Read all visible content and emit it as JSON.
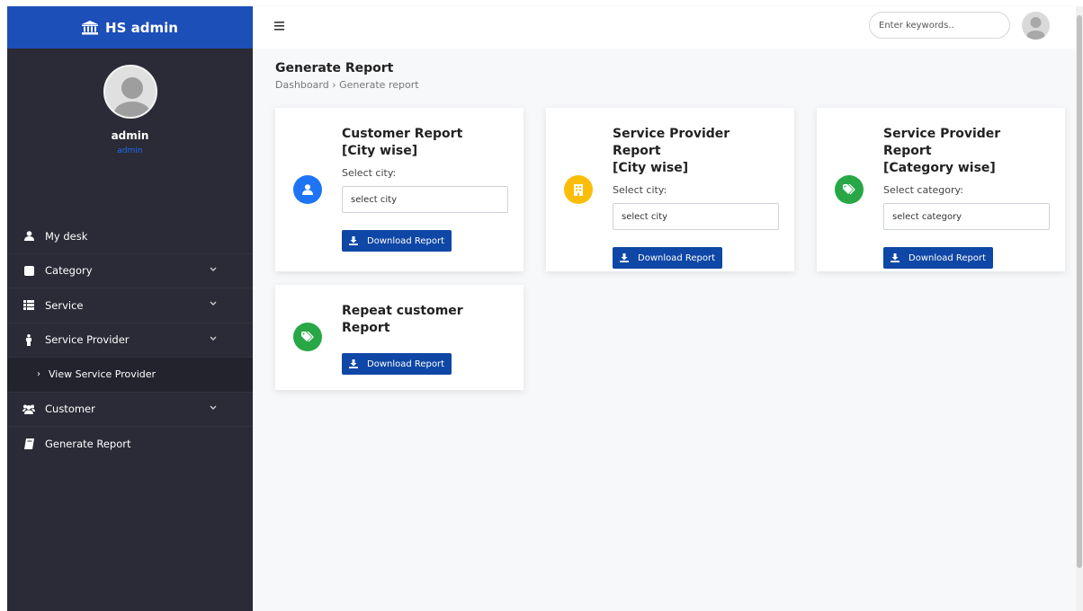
{
  "brand": {
    "title": "HS admin",
    "icon": "bank-icon"
  },
  "profile": {
    "name": "admin",
    "role": "admin"
  },
  "sidebar": {
    "items": [
      {
        "label": "My desk",
        "icon": "user-icon"
      },
      {
        "label": "Category",
        "icon": "square-icon",
        "has_children": true
      },
      {
        "label": "Service",
        "icon": "list-icon",
        "has_children": true
      },
      {
        "label": "Service Provider",
        "icon": "person-icon",
        "has_children": true
      },
      {
        "label": "View Service Provider",
        "icon": "chevron-right-icon",
        "sub": true
      },
      {
        "label": "Customer",
        "icon": "users-icon",
        "has_children": true
      },
      {
        "label": "Generate Report",
        "icon": "book-icon"
      }
    ]
  },
  "topbar": {
    "search_placeholder": "Enter keywords.."
  },
  "page": {
    "title": "Generate Report",
    "breadcrumb": "Dashboard › Generate report"
  },
  "cards": [
    {
      "title_line1": "Customer Report",
      "title_line2": "[City wise]",
      "field_label": "Select city:",
      "select_value": "select city",
      "button": "Download Report",
      "icon": "user-icon",
      "icon_color": "#1e74f5"
    },
    {
      "title_line1": "Service Provider Report",
      "title_line2": "[City wise]",
      "field_label": "Select city:",
      "select_value": "select city",
      "button": "Download Report",
      "icon": "building-icon",
      "icon_color": "#fbbd08"
    },
    {
      "title_line1": "Service Provider Report",
      "title_line2": "[Category wise]",
      "field_label": "Select category:",
      "select_value": "select category",
      "button": "Download Report",
      "icon": "tag-icon",
      "icon_color": "#27a745"
    },
    {
      "title_line1": "Repeat customer",
      "title_line2": "Report",
      "button": "Download Report",
      "icon": "tag-icon",
      "icon_color": "#27a745"
    }
  ],
  "colors": {
    "sidebar_bg": "#2a2b36",
    "brand_bg": "#1d4fb8",
    "button_bg": "#0f47a6",
    "main_bg": "#f7f8fa"
  }
}
